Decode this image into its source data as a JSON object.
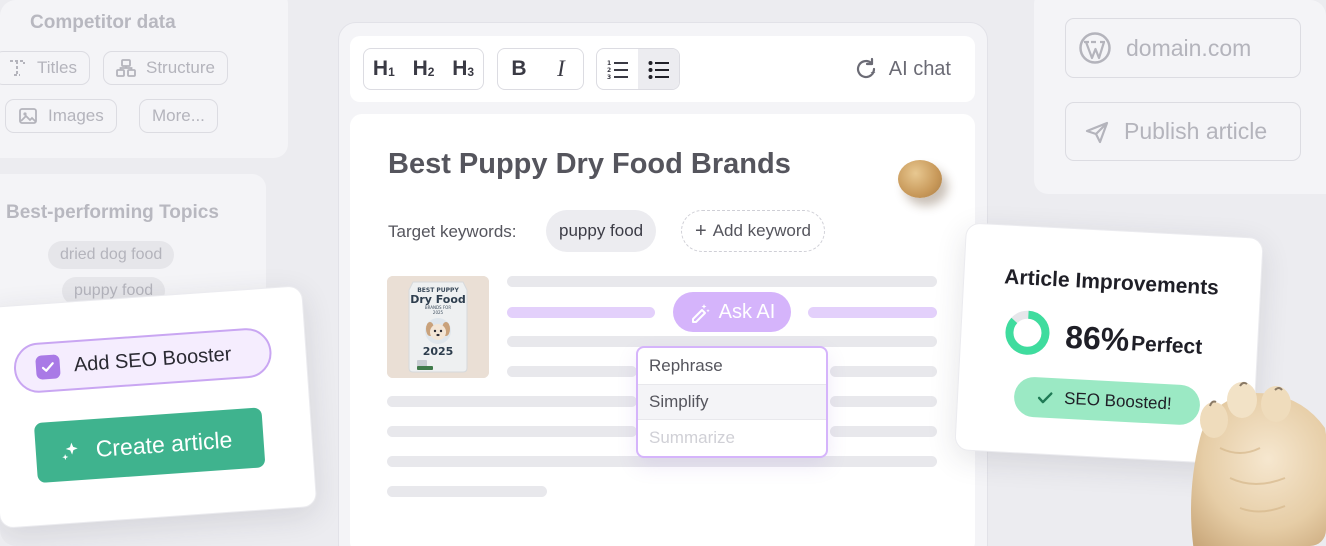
{
  "competitor": {
    "title": "Competitor data",
    "chips": [
      "Titles",
      "Structure",
      "Images",
      "More..."
    ]
  },
  "topics": {
    "title": "Best-performing Topics",
    "items": [
      "dried dog food",
      "puppy food"
    ]
  },
  "create": {
    "seo_booster_label": "Add SEO Booster",
    "seo_booster_checked": true,
    "create_label": "Create article"
  },
  "toolbar": {
    "h1": "H",
    "h2": "H",
    "h3": "H",
    "h1_sub": "1",
    "h2_sub": "2",
    "h3_sub": "3",
    "bold": "B",
    "italic": "I",
    "ai_chat": "AI chat"
  },
  "doc": {
    "title": "Best Puppy Dry Food Brands",
    "keywords_label": "Target keywords:",
    "keyword": "puppy food",
    "add_keyword": "Add keyword",
    "ask_ai": "Ask AI",
    "menu": [
      "Rephrase",
      "Simplify",
      "Summarize"
    ],
    "thumb": {
      "line1": "BEST PUPPY",
      "line2": "Dry Food",
      "line3": "BRANDS FOR",
      "year_small": "2025",
      "year": "2025"
    }
  },
  "publish": {
    "domain": "domain.com",
    "publish_label": "Publish article"
  },
  "improvements": {
    "title": "Article Improvements",
    "percent": "86%",
    "percent_value": 86,
    "percent_label": "Perfect",
    "badge": "SEO Boosted!"
  },
  "colors": {
    "accent_green": "#3fb38e",
    "accent_purple": "#a97ae6",
    "boosted_green": "#9be9c4",
    "donut_green": "#3fdc9e"
  }
}
